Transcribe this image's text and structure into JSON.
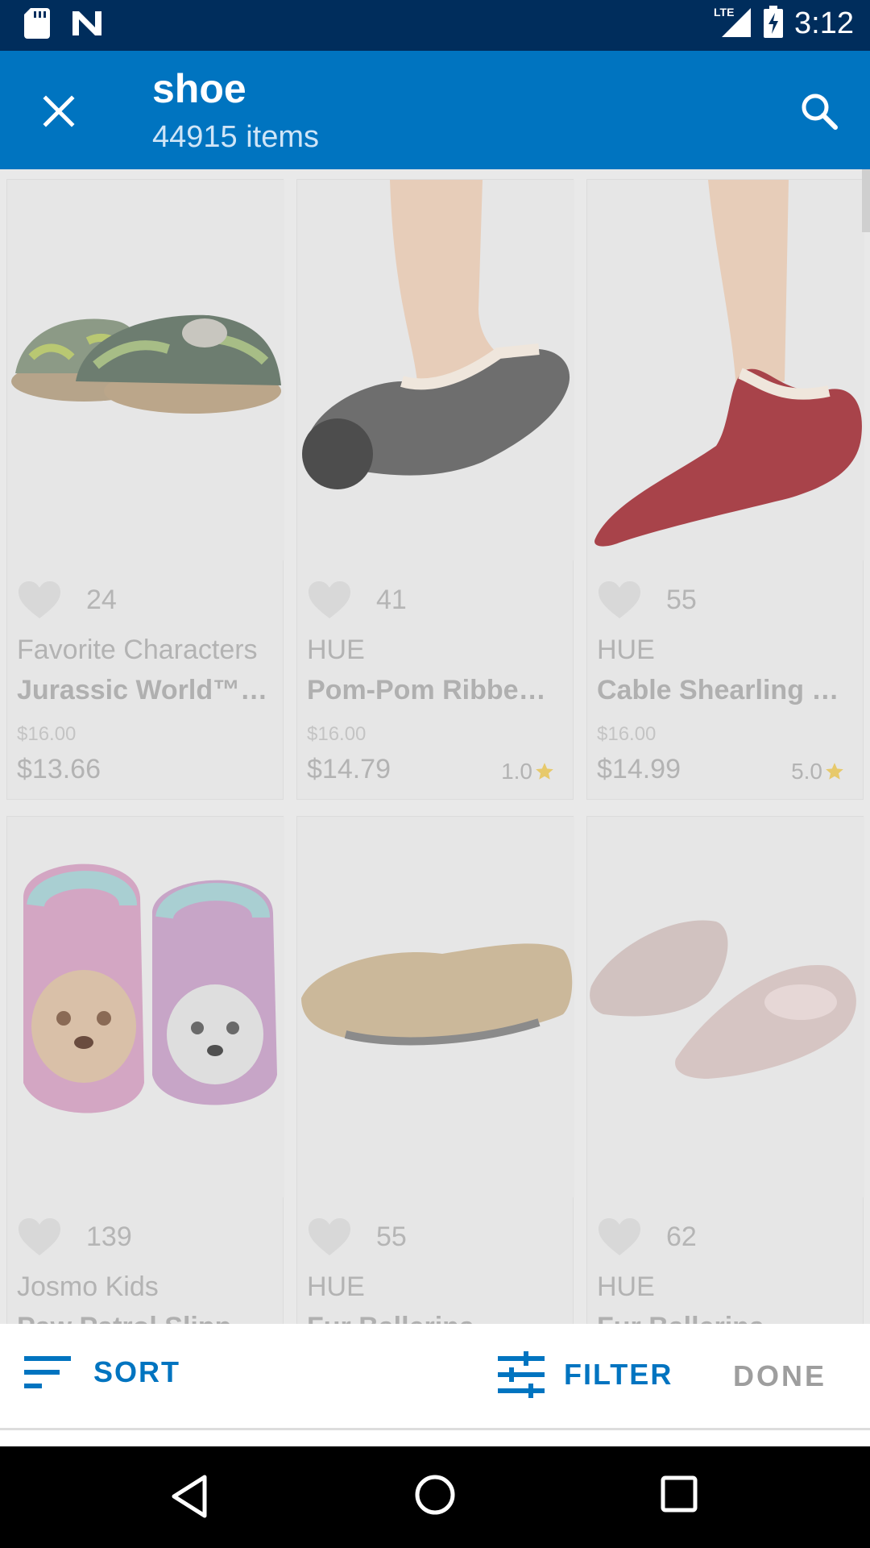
{
  "status_bar": {
    "time": "3:12",
    "network": "LTE",
    "icons": [
      "sd-card-icon",
      "n-logo-icon",
      "signal-icon",
      "battery-charging-icon"
    ]
  },
  "app_bar": {
    "title": "shoe",
    "subtitle": "44915 items",
    "close_icon": "close-icon",
    "search_icon": "search-icon"
  },
  "products": [
    {
      "fav_count": "24",
      "brand": "Favorite Characters",
      "name": "Jurassic World™ …",
      "original_price": "$16.00",
      "price": "$13.66",
      "rating": ""
    },
    {
      "fav_count": "41",
      "brand": "HUE",
      "name": "Pom-Pom Ribbe…",
      "original_price": "$16.00",
      "price": "$14.79",
      "rating": "1.0"
    },
    {
      "fav_count": "55",
      "brand": "HUE",
      "name": "Cable Shearling …",
      "original_price": "$16.00",
      "price": "$14.99",
      "rating": "5.0"
    },
    {
      "fav_count": "139",
      "brand": "Josmo Kids",
      "name": "Paw Patrol Slipp…"
    },
    {
      "fav_count": "55",
      "brand": "HUE",
      "name": "Fur Ballerina"
    },
    {
      "fav_count": "62",
      "brand": "HUE",
      "name": "Fur Ballerina"
    }
  ],
  "toolbar": {
    "sort_label": "SORT",
    "filter_label": "FILTER",
    "done_label": "DONE"
  },
  "colors": {
    "status_bar": "#002d5c",
    "app_bar": "#0074c0",
    "accent": "#0074c0",
    "star": "#e7c96b"
  }
}
